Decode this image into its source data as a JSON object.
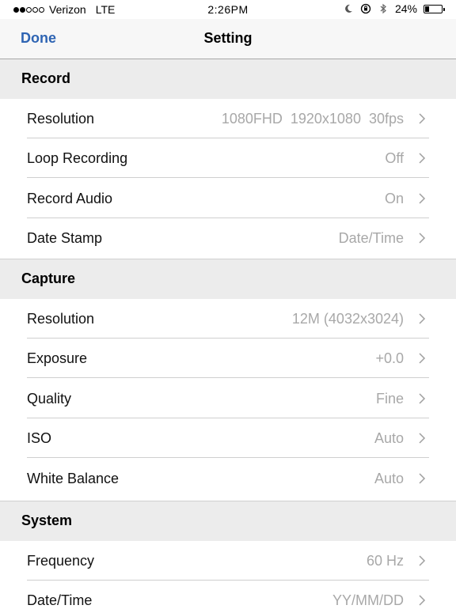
{
  "status_bar": {
    "carrier": "Verizon",
    "network": "LTE",
    "time": "2:26PM",
    "battery": "24%",
    "battery_level": 0.24,
    "signal_bars_filled": 2,
    "signal_bars_total": 5
  },
  "nav": {
    "done_label": "Done",
    "title": "Setting",
    "accent_color": "#2e64b3"
  },
  "sections": [
    {
      "title": "Record",
      "rows": [
        {
          "label": "Resolution",
          "value": "1080FHD  1920x1080  30fps"
        },
        {
          "label": "Loop Recording",
          "value": "Off"
        },
        {
          "label": "Record Audio",
          "value": "On"
        },
        {
          "label": "Date Stamp",
          "value": "Date/Time"
        }
      ]
    },
    {
      "title": "Capture",
      "rows": [
        {
          "label": "Resolution",
          "value": "12M (4032x3024)"
        },
        {
          "label": "Exposure",
          "value": "+0.0"
        },
        {
          "label": "Quality",
          "value": "Fine"
        },
        {
          "label": "ISO",
          "value": "Auto"
        },
        {
          "label": "White Balance",
          "value": "Auto"
        }
      ]
    },
    {
      "title": "System",
      "rows": [
        {
          "label": "Frequency",
          "value": "60 Hz"
        },
        {
          "label": "Date/Time",
          "value": "YY/MM/DD"
        }
      ]
    }
  ]
}
